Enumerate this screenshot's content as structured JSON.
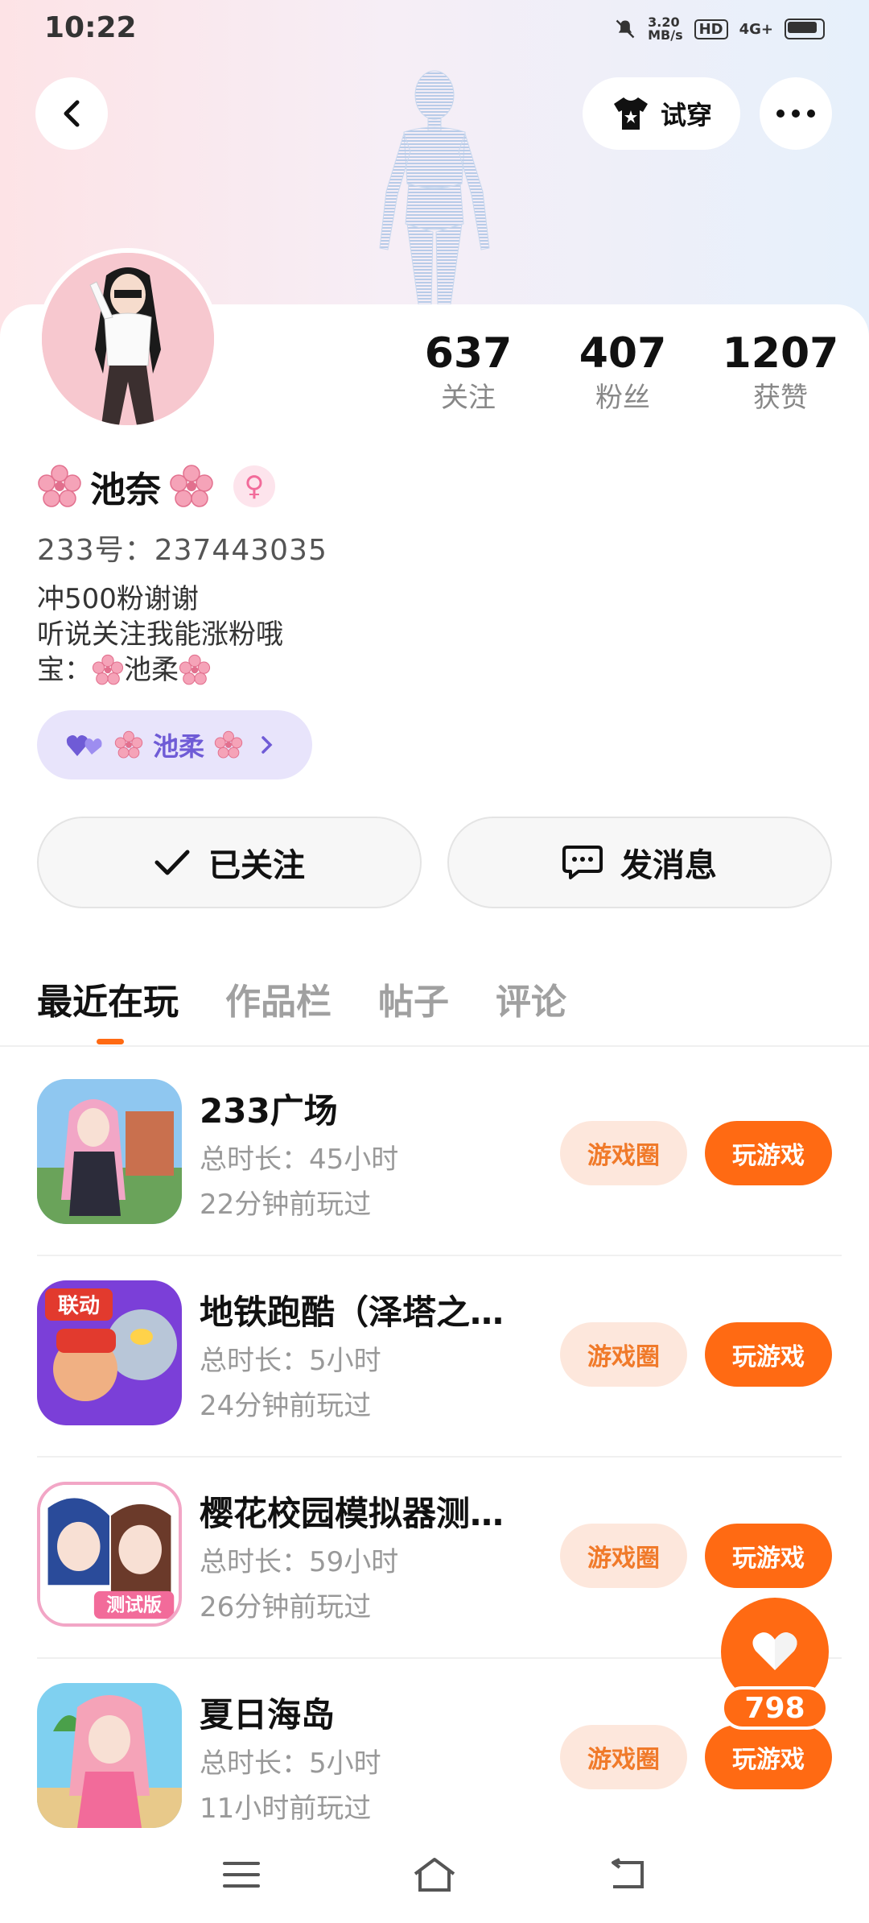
{
  "status_bar": {
    "time": "10:22",
    "net_speed_top": "3.20",
    "net_speed_unit": "MB/s",
    "hd": "HD",
    "signal": "4G+"
  },
  "header": {
    "try_on_label": "试穿"
  },
  "profile": {
    "name": "池奈",
    "uid_label": "233号：",
    "uid": "237443035",
    "bio_line1": "冲500粉谢谢",
    "bio_line2": "听说关注我能涨粉哦",
    "bio_line3_prefix": "宝：",
    "bio_line3_name": "池柔",
    "partner_tag": "池柔"
  },
  "stats": [
    {
      "value": "637",
      "label": "关注"
    },
    {
      "value": "407",
      "label": "粉丝"
    },
    {
      "value": "1207",
      "label": "获赞"
    }
  ],
  "actions": {
    "follow_label": "已关注",
    "message_label": "发消息"
  },
  "tabs": [
    {
      "label": "最近在玩",
      "active": true
    },
    {
      "label": "作品栏",
      "active": false
    },
    {
      "label": "帖子",
      "active": false
    },
    {
      "label": "评论",
      "active": false
    }
  ],
  "games": [
    {
      "title": "233广场",
      "duration": "总时长：45小时",
      "last_played": "22分钟前玩过",
      "circle_label": "游戏圈",
      "play_label": "玩游戏"
    },
    {
      "title": "地铁跑酷（泽塔之…",
      "duration": "总时长：5小时",
      "last_played": "24分钟前玩过",
      "circle_label": "游戏圈",
      "play_label": "玩游戏",
      "icon_badge": "联动"
    },
    {
      "title": "樱花校园模拟器测…",
      "duration": "总时长：59小时",
      "last_played": "26分钟前玩过",
      "circle_label": "游戏圈",
      "play_label": "玩游戏",
      "icon_badge": "测试版"
    },
    {
      "title": "夏日海岛",
      "duration": "总时长：5小时",
      "last_played": "11小时前玩过",
      "circle_label": "游戏圈",
      "play_label": "玩游戏"
    }
  ],
  "like_fab": {
    "count": "798"
  },
  "colors": {
    "accent": "#ff6a13",
    "accent_light": "#fde7dc",
    "tag_bg": "#e8e4fb",
    "tag_text": "#6f5bd6"
  }
}
